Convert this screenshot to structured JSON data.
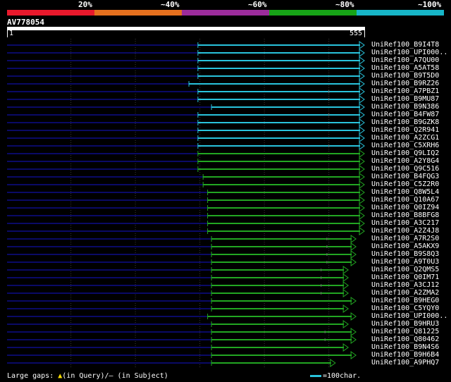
{
  "legend": {
    "segments": [
      {
        "color": "#e8192c"
      },
      {
        "color": "#e5701e"
      },
      {
        "color": "#9b2c9b"
      },
      {
        "color": "#17a317"
      },
      {
        "color": "#17b6c8"
      }
    ],
    "labels": [
      "20%",
      "~40%",
      "~60%",
      "~80%",
      "~100%"
    ]
  },
  "query": {
    "name": "AV778054",
    "start": "1",
    "end": "555",
    "length": 555
  },
  "colors": {
    "cyan": "#29c3dc",
    "green": "#22a622",
    "faint": "#0a0a66",
    "grid": "#3a3a3a"
  },
  "hits": [
    {
      "id": "UniRef100_B9I4T8",
      "start": 297,
      "end": 555,
      "color": "cyan",
      "mark": 0
    },
    {
      "id": "UniRef100_UPI000..",
      "start": 297,
      "end": 555,
      "color": "cyan",
      "mark": 0
    },
    {
      "id": "UniRef100_A7QU00",
      "start": 297,
      "end": 555,
      "color": "cyan",
      "mark": 0
    },
    {
      "id": "UniRef100_A5AT58",
      "start": 297,
      "end": 555,
      "color": "cyan",
      "mark": 0
    },
    {
      "id": "UniRef100_B9T5D0",
      "start": 297,
      "end": 555,
      "color": "cyan",
      "mark": 0
    },
    {
      "id": "UniRef100_B9RZ26",
      "start": 283,
      "end": 555,
      "color": "cyan",
      "mark": 0
    },
    {
      "id": "UniRef100_A7PBZ1",
      "start": 297,
      "end": 555,
      "color": "cyan",
      "mark": 500
    },
    {
      "id": "UniRef100_B9MU87",
      "start": 297,
      "end": 555,
      "color": "cyan",
      "mark": 500
    },
    {
      "id": "UniRef100_B9N386",
      "start": 318,
      "end": 555,
      "color": "cyan",
      "mark": 0
    },
    {
      "id": "UniRef100_B4FW87",
      "start": 297,
      "end": 555,
      "color": "cyan",
      "mark": 500
    },
    {
      "id": "UniRef100_B9GZK8",
      "start": 297,
      "end": 555,
      "color": "cyan",
      "mark": 0
    },
    {
      "id": "UniRef100_Q2R941",
      "start": 297,
      "end": 555,
      "color": "cyan",
      "mark": 0
    },
    {
      "id": "UniRef100_A2ZCG1",
      "start": 297,
      "end": 555,
      "color": "cyan",
      "mark": 0
    },
    {
      "id": "UniRef100_C5XRH6",
      "start": 297,
      "end": 555,
      "color": "cyan",
      "mark": 500
    },
    {
      "id": "UniRef100_Q9LIQ2",
      "start": 297,
      "end": 555,
      "color": "green",
      "mark": 0
    },
    {
      "id": "UniRef100_A2Y8G4",
      "start": 297,
      "end": 555,
      "color": "green",
      "mark": 0
    },
    {
      "id": "UniRef100_Q9C516",
      "start": 297,
      "end": 555,
      "color": "green",
      "mark": 0
    },
    {
      "id": "UniRef100_B4FQG3",
      "start": 305,
      "end": 555,
      "color": "green",
      "mark": 0
    },
    {
      "id": "UniRef100_C5Z2R0",
      "start": 305,
      "end": 555,
      "color": "green",
      "mark": 0
    },
    {
      "id": "UniRef100_Q8W5L4",
      "start": 312,
      "end": 555,
      "color": "green",
      "mark": 0
    },
    {
      "id": "UniRef100_Q10A67",
      "start": 312,
      "end": 555,
      "color": "green",
      "mark": 0
    },
    {
      "id": "UniRef100_Q0IZ94",
      "start": 312,
      "end": 555,
      "color": "green",
      "mark": 0
    },
    {
      "id": "UniRef100_B8BFG8",
      "start": 312,
      "end": 555,
      "color": "green",
      "mark": 0
    },
    {
      "id": "UniRef100_A3C217",
      "start": 312,
      "end": 555,
      "color": "green",
      "mark": 0
    },
    {
      "id": "UniRef100_A2Z4J8",
      "start": 312,
      "end": 555,
      "color": "green",
      "mark": 0
    },
    {
      "id": "UniRef100_A7R2S0",
      "start": 318,
      "end": 542,
      "color": "green",
      "mark": 497
    },
    {
      "id": "UniRef100_A5AKX9",
      "start": 318,
      "end": 542,
      "color": "green",
      "mark": 497
    },
    {
      "id": "UniRef100_B9S8Q3",
      "start": 318,
      "end": 542,
      "color": "green",
      "mark": 497
    },
    {
      "id": "UniRef100_A9T0U3",
      "start": 318,
      "end": 542,
      "color": "green",
      "mark": 497
    },
    {
      "id": "UniRef100_Q2QMS5",
      "start": 318,
      "end": 530,
      "color": "green",
      "mark": 488
    },
    {
      "id": "UniRef100_Q0IM71",
      "start": 318,
      "end": 530,
      "color": "green",
      "mark": 488
    },
    {
      "id": "UniRef100_A3CJ12",
      "start": 318,
      "end": 530,
      "color": "green",
      "mark": 488
    },
    {
      "id": "UniRef100_A2ZMA2",
      "start": 318,
      "end": 530,
      "color": "green",
      "mark": 488
    },
    {
      "id": "UniRef100_B9HEG0",
      "start": 318,
      "end": 542,
      "color": "green",
      "mark": 0
    },
    {
      "id": "UniRef100_C5YQY0",
      "start": 318,
      "end": 530,
      "color": "green",
      "mark": 0
    },
    {
      "id": "UniRef100_UPI000..",
      "start": 312,
      "end": 542,
      "color": "green",
      "mark": 0
    },
    {
      "id": "UniRef100_B9HRU3",
      "start": 318,
      "end": 530,
      "color": "green",
      "mark": 0
    },
    {
      "id": "UniRef100_Q81225",
      "start": 318,
      "end": 542,
      "color": "green",
      "mark": 494
    },
    {
      "id": "UniRef100_Q80462",
      "start": 318,
      "end": 542,
      "color": "green",
      "mark": 494
    },
    {
      "id": "UniRef100_B9N4S6",
      "start": 318,
      "end": 530,
      "color": "green",
      "mark": 0
    },
    {
      "id": "UniRef100_B9H6B4",
      "start": 318,
      "end": 542,
      "color": "green",
      "mark": 0
    },
    {
      "id": "UniRef100_A9PHQ7",
      "start": 318,
      "end": 510,
      "color": "green",
      "mark": 0
    }
  ],
  "footer": {
    "large_gaps_label": "Large gaps: ",
    "in_query_label": "(in Query)/",
    "in_subject_label": "– (in Subject)",
    "scale_label": "=100char."
  }
}
